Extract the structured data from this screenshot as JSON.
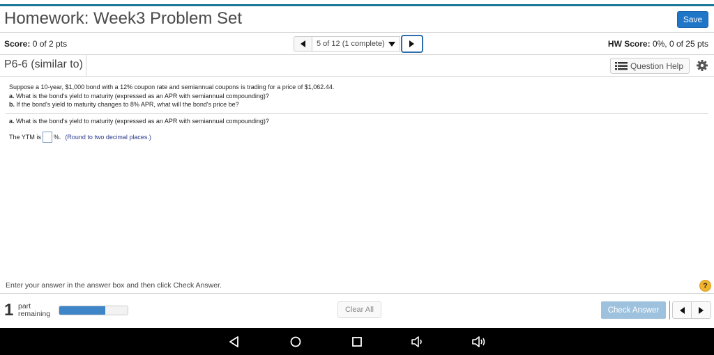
{
  "header": {
    "title": "Homework: Week3 Problem Set",
    "save_label": "Save"
  },
  "score_bar": {
    "score_label": "Score:",
    "score_value": "0 of 2 pts",
    "hw_score_label": "HW Score:",
    "hw_score_value": "0%, 0 of 25 pts",
    "navigator": {
      "current": "5 of 12 (1 complete)",
      "prev_icon": "triangle-left-icon",
      "next_icon": "triangle-right-icon",
      "dropdown_icon": "triangle-down-icon"
    }
  },
  "question_bar": {
    "title": "P6-6 (similar to)",
    "help_label": "Question Help",
    "help_icon": "list-icon",
    "settings_icon": "gear-icon"
  },
  "problem": {
    "statement": "Suppose a 10-year, $1,000 bond with a 12% coupon rate and semiannual coupons is trading for a price of $1,062.44.",
    "part_a_label": "a.",
    "part_a_text": "What is the bond's yield to maturity (expressed as an APR with semiannual compounding)?",
    "part_b_label": "b.",
    "part_b_text": "If the bond's yield to maturity changes to 8% APR, what will the bond's price be?"
  },
  "current_part": {
    "label": "a.",
    "question": "What is the bond's yield to maturity (expressed as an APR with semiannual compounding)?",
    "answer_prefix": "The YTM is",
    "answer_value": "",
    "answer_suffix": "%.",
    "hint": "(Round to two decimal places.)"
  },
  "footer": {
    "instruction": "Enter your answer in the answer box and then click Check Answer.",
    "help_icon_text": "?",
    "parts_remaining_count": "1",
    "parts_remaining_line1": "part",
    "parts_remaining_line2": "remaining",
    "progress_percent": 67,
    "clear_all_label": "Clear All",
    "check_answer_label": "Check Answer"
  },
  "colors": {
    "accent_top": "#1a7596",
    "save_button": "#1f75c6",
    "check_answer_disabled": "#9ec2de",
    "progress_fill": "#3f86c9",
    "help_circle": "#f0b431"
  },
  "android_nav": {
    "icons": [
      "back-icon",
      "home-icon",
      "recents-icon",
      "volume-down-icon",
      "volume-up-icon"
    ]
  }
}
